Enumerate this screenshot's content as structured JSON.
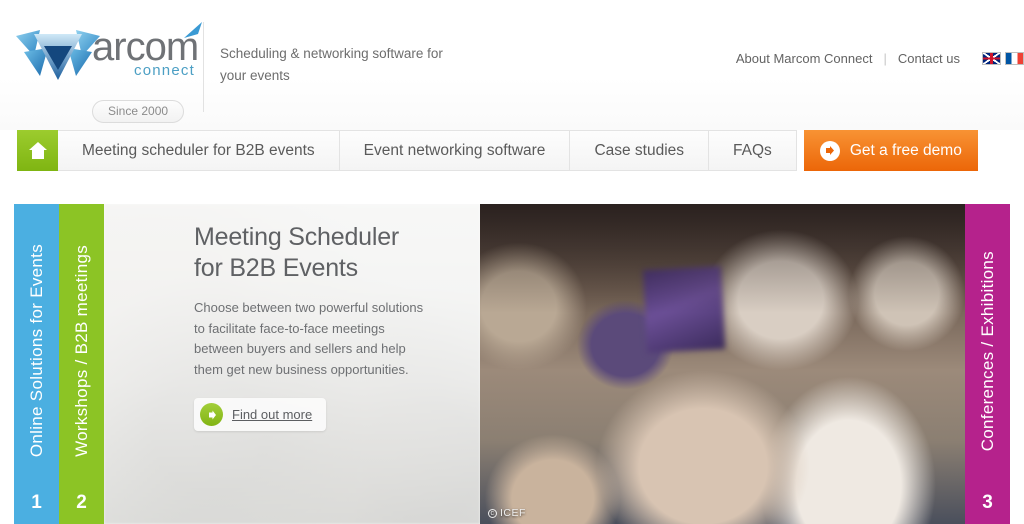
{
  "brand": {
    "word": "arcom",
    "sub": "connect",
    "since": "Since 2000",
    "tagline": "Scheduling & networking software for your events"
  },
  "topnav": {
    "about": "About Marcom Connect",
    "separator": "|",
    "contact": "Contact us",
    "flags": [
      {
        "name": "flag-uk-icon",
        "label": "English"
      },
      {
        "name": "flag-fr-icon",
        "label": "Français"
      }
    ]
  },
  "mainnav": {
    "home_icon": "home-icon",
    "tabs": [
      {
        "label": "Meeting scheduler for B2B events"
      },
      {
        "label": "Event networking software"
      },
      {
        "label": "Case studies"
      },
      {
        "label": "FAQs"
      }
    ],
    "demo": {
      "label": "Get a free demo",
      "icon": "arrow-right-circle-icon"
    }
  },
  "hero": {
    "tabs": [
      {
        "label": "Online Solutions for Events",
        "number": "1",
        "color": "#4bafe1"
      },
      {
        "label": "Workshops / B2B meetings",
        "number": "2",
        "color": "#8cc425"
      },
      {
        "label": "Conferences / Exhibitions",
        "number": "3",
        "color": "#b5228c"
      }
    ],
    "heading": "Meeting Scheduler\nfor B2B Events",
    "body": "Choose between two powerful solutions to facilitate face-to-face meetings between buyers and sellers and help them get new business opportunities.",
    "cta": {
      "label": "Find out more",
      "icon": "arrow-right-circle-icon"
    },
    "photo_credit": {
      "symbol": "c",
      "label": "ICEF"
    }
  },
  "colors": {
    "green": "#8cc425",
    "blue": "#4bafe1",
    "magenta": "#b5228c",
    "orange": "#ec6608",
    "text": "#5f6164"
  }
}
